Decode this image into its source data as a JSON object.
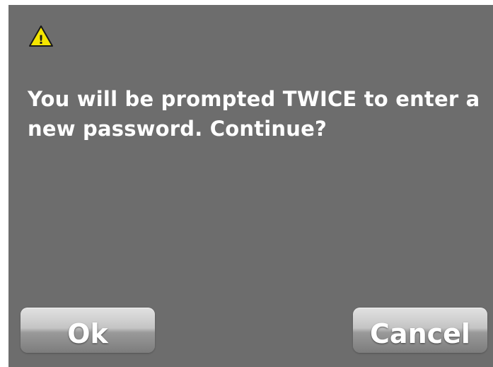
{
  "dialog": {
    "icon": "warning-icon",
    "icon_glyph": "!",
    "message": "You will be prompted TWICE to enter a new password. Continue?",
    "background_color": "#6d6d6d",
    "text_color": "#ffffff",
    "warning_color": "#f5e600"
  },
  "buttons": {
    "ok_label": "Ok",
    "cancel_label": "Cancel"
  }
}
